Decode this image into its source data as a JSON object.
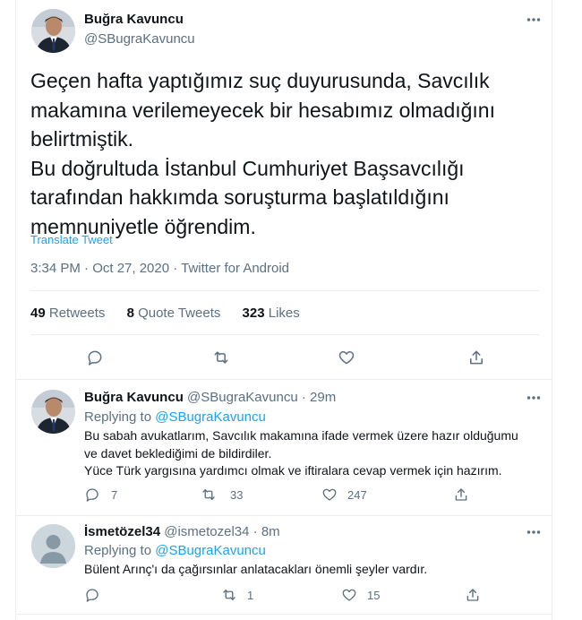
{
  "main_tweet": {
    "author_name": "Buğra Kavuncu",
    "author_handle": "@SBugraKavuncu",
    "lines": [
      "Geçen hafta yaptığımız suç duyurusunda, Savcılık",
      "makamına verilemeyecek bir hesabımız olmadığını",
      "belirtmiştik.",
      "Bu doğrultuda İstanbul Cumhuriyet Başsavcılığı",
      "tarafından hakkımda soruşturma başlatıldığını",
      "memnuniyetle öğrendim."
    ],
    "translate_label": "Translate Tweet",
    "meta": "3:34 PM · Oct 27, 2020 · Twitter for Android",
    "retweets_count": "49",
    "retweets_label": "Retweets",
    "quotes_count": "8",
    "quotes_label": "Quote Tweets",
    "likes_count": "323",
    "likes_label": "Likes"
  },
  "replies": [
    {
      "author_name": "Buğra Kavuncu",
      "author_handle": "@SBugraKavuncu",
      "time": "29m",
      "replying_prefix": "Replying to",
      "replying_to": "@SBugraKavuncu",
      "lines": [
        "Bu sabah avukatlarım, Savcılık makamına ifade vermek üzere hazır olduğumu",
        "ve davet beklediğimi de bildirdiler.",
        "Yüce Türk yargısına yardımcı olmak ve iftiralara cevap vermek için hazırım."
      ],
      "reply_count": "7",
      "retweet_count": "33",
      "like_count": "247"
    },
    {
      "author_name": "İsmetözel34",
      "author_handle": "@ismetozel34",
      "time": "8m",
      "replying_prefix": "Replying to",
      "replying_to": "@SBugraKavuncu",
      "lines": [
        "Bülent Arınç'ı da çağırsınlar anlatacakları önemli şeyler vardır."
      ],
      "reply_count": "",
      "retweet_count": "1",
      "like_count": "15"
    }
  ],
  "colors": {
    "link": "#1da1f2",
    "secondary": "#5b7083",
    "text": "#0f1419",
    "border": "#ebeef0"
  }
}
